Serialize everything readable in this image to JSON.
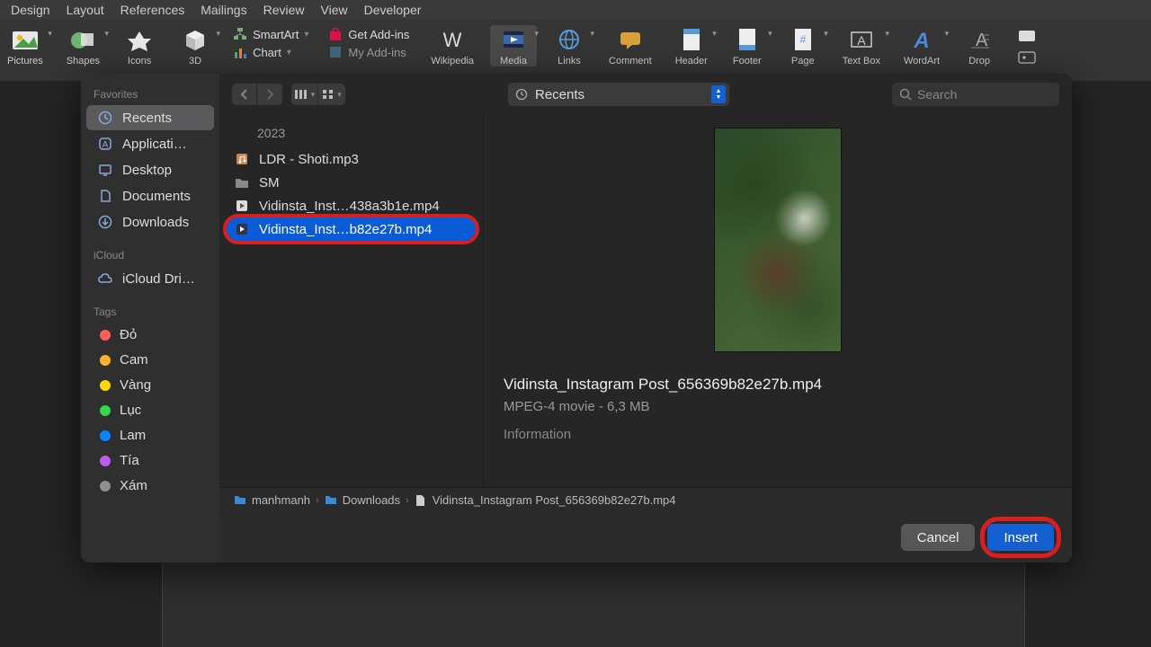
{
  "menu": [
    "Design",
    "Layout",
    "References",
    "Mailings",
    "Review",
    "View",
    "Developer"
  ],
  "ribbon": {
    "pictures": "Pictures",
    "shapes": "Shapes",
    "icons": "Icons",
    "threeD": "3D",
    "smartart": "SmartArt",
    "chart": "Chart",
    "getaddins": "Get Add-ins",
    "myaddins": "My Add-ins",
    "wikipedia": "Wikipedia",
    "media": "Media",
    "links": "Links",
    "comment": "Comment",
    "header": "Header",
    "footer": "Footer",
    "page": "Page",
    "textbox": "Text Box",
    "wordart": "WordArt",
    "drop": "Drop"
  },
  "sidebar": {
    "favorites_label": "Favorites",
    "favorites": [
      {
        "icon": "clock",
        "label": "Recents",
        "selected": true
      },
      {
        "icon": "app",
        "label": "Applicati…"
      },
      {
        "icon": "desktop",
        "label": "Desktop"
      },
      {
        "icon": "doc",
        "label": "Documents"
      },
      {
        "icon": "download",
        "label": "Downloads"
      }
    ],
    "icloud_label": "iCloud",
    "icloud": [
      {
        "icon": "cloud",
        "label": "iCloud Dri…"
      }
    ],
    "tags_label": "Tags",
    "tags": [
      {
        "color": "#ff5f56",
        "label": "Đỏ"
      },
      {
        "color": "#ffb02e",
        "label": "Cam"
      },
      {
        "color": "#ffd60a",
        "label": "Vàng"
      },
      {
        "color": "#32d74b",
        "label": "Lục"
      },
      {
        "color": "#0a84ff",
        "label": "Lam"
      },
      {
        "color": "#bf5af2",
        "label": "Tía"
      },
      {
        "color": "#8e8e93",
        "label": "Xám"
      }
    ]
  },
  "toolbar": {
    "location": "Recents",
    "search_placeholder": "Search"
  },
  "files": {
    "year": "2023",
    "items": [
      {
        "icon": "audio",
        "name": "LDR - Shoti.mp3"
      },
      {
        "icon": "folder",
        "name": "SM"
      },
      {
        "icon": "video",
        "name": "Vidinsta_Inst…438a3b1e.mp4"
      },
      {
        "icon": "video",
        "name": "Vidinsta_Inst…b82e27b.mp4",
        "selected": true
      }
    ]
  },
  "preview": {
    "title": "Vidinsta_Instagram Post_656369b82e27b.mp4",
    "subtitle": "MPEG-4 movie - 6,3 MB",
    "info": "Information"
  },
  "path": [
    {
      "icon": "folder-blue",
      "label": "manhmanh"
    },
    {
      "icon": "folder-blue",
      "label": "Downloads"
    },
    {
      "icon": "file",
      "label": "Vidinsta_Instagram Post_656369b82e27b.mp4"
    }
  ],
  "buttons": {
    "cancel": "Cancel",
    "insert": "Insert"
  }
}
